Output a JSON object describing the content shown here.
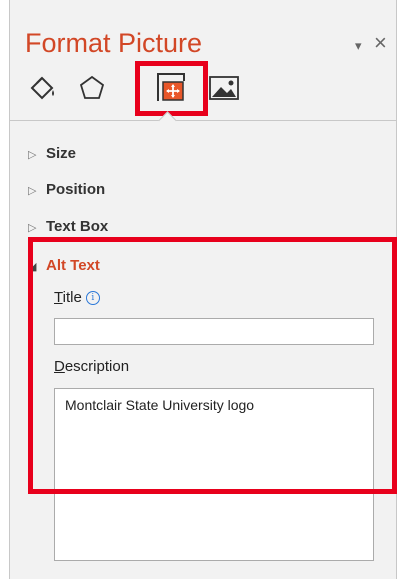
{
  "pane": {
    "title": "Format Picture",
    "dropdown_glyph": "▾",
    "close_glyph": "×"
  },
  "tabs": [
    {
      "name": "fill-line-icon"
    },
    {
      "name": "effects-icon"
    },
    {
      "name": "size-properties-icon",
      "selected": true
    },
    {
      "name": "picture-icon"
    }
  ],
  "sections": {
    "size": "Size",
    "position": "Position",
    "textbox": "Text Box",
    "alttext": "Alt Text"
  },
  "alt_text": {
    "title_label_first": "T",
    "title_label_rest": "itle",
    "title_value": "",
    "description_label_first": "D",
    "description_label_rest": "escription",
    "description_value": "Montclair State University logo"
  },
  "colors": {
    "accent": "#d24726",
    "highlight": "#e8001c"
  }
}
